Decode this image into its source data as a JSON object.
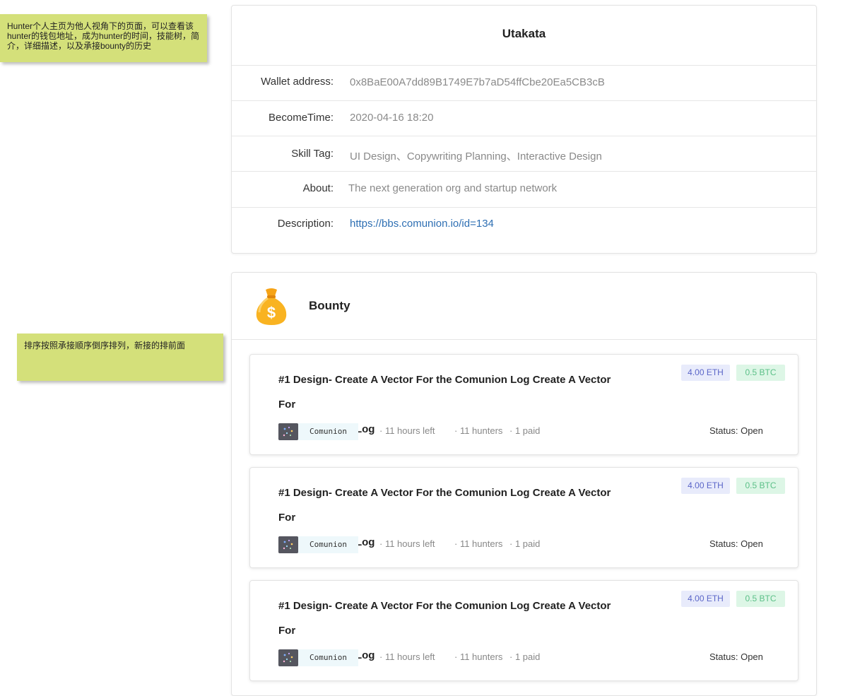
{
  "notes": {
    "profile_note": "Hunter个人主页为他人视角下的页面，可以查看该hunter的钱包地址，成为hunter的时间，技能树，简介，详细描述，以及承接bounty的历史",
    "bounty_note": "排序按照承接顺序倒序排列，新接的排前面"
  },
  "profile": {
    "name": "Utakata",
    "fields": [
      {
        "label": "Wallet address:",
        "value": "0x8BaE00A7dd89B1749E7b7aD54ffCbe20Ea5CB3cB"
      },
      {
        "label": "BecomeTime:",
        "value": "2020-04-16 18:20"
      },
      {
        "label": "Skill Tag:",
        "value": "UI Design、Copywriting  Planning、Interactive Design"
      },
      {
        "label": "About:",
        "value": "The next generation org and startup network"
      },
      {
        "label": "Description:",
        "value": "https://bbs.comunion.io/id=134"
      }
    ]
  },
  "bounty": {
    "title": "Bounty",
    "icon": "money-bag-icon",
    "items": [
      {
        "title_line1": "#1 Design- Create A Vector For the Comunion Log Create A Vector For",
        "title_line2": " the Comunion Log",
        "eth": "4.00 ETH",
        "btc": "0.5 BTC",
        "org": "Comunion",
        "time_left": "· 11 hours left",
        "hunters": "· 11 hunters",
        "paid": "·  1 paid",
        "status": "Status: Open"
      },
      {
        "title_line1": "#1 Design- Create A Vector For the Comunion Log Create A Vector For",
        "title_line2": " the Comunion Log",
        "eth": "4.00 ETH",
        "btc": "0.5 BTC",
        "org": "Comunion",
        "time_left": "· 11 hours left",
        "hunters": "· 11 hunters",
        "paid": "·  1 paid",
        "status": "Status: Open"
      },
      {
        "title_line1": "#1 Design- Create A Vector For the Comunion Log Create A Vector For",
        "title_line2": " the Comunion Log",
        "eth": "4.00 ETH",
        "btc": "0.5 BTC",
        "org": "Comunion",
        "time_left": "· 11 hours left",
        "hunters": "· 11 hunters",
        "paid": "·  1 paid",
        "status": "Status: Open"
      }
    ]
  },
  "colors": {
    "note_bg": "#d4e07a",
    "eth_chip_bg": "#e8ebfb",
    "eth_chip_text": "#5b66c8",
    "btc_chip_bg": "#ddf6e6",
    "btc_chip_text": "#5cc088",
    "link": "#2e6fb3"
  }
}
